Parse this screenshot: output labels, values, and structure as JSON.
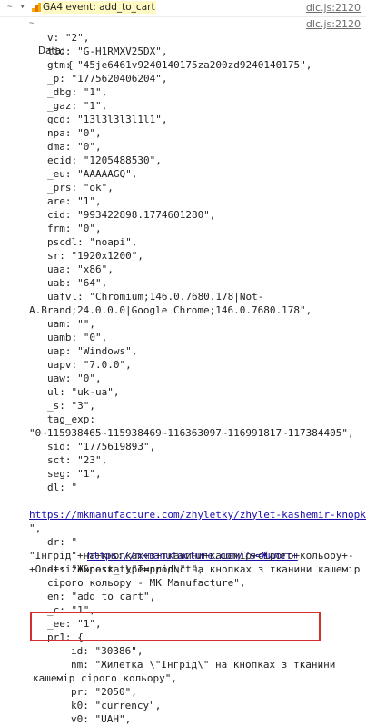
{
  "header": {
    "toggle_glyph": "~",
    "event_label": "GA4 event: add_to_cart",
    "source": "dlc.js:2120"
  },
  "data_header": {
    "toggle_glyph": "~",
    "label": "Data:",
    "brace": "{",
    "source": "dlc.js:2120"
  },
  "rows": [
    {
      "indent": 52,
      "text": "v: \"2\","
    },
    {
      "indent": 52,
      "text": "tid: \"G-H1RMXV25DX\","
    },
    {
      "indent": 52,
      "text": "gtm: \"45je6461v9240140175za200zd9240140175\","
    },
    {
      "indent": 52,
      "text": "_p: \"1775620406204\","
    },
    {
      "indent": 52,
      "text": "_dbg: \"1\","
    },
    {
      "indent": 52,
      "text": "_gaz: \"1\","
    },
    {
      "indent": 52,
      "text": "gcd: \"13l3l3l3l1l1\","
    },
    {
      "indent": 52,
      "text": "npa: \"0\","
    },
    {
      "indent": 52,
      "text": "dma: \"0\","
    },
    {
      "indent": 52,
      "text": "ecid: \"1205488530\","
    },
    {
      "indent": 52,
      "text": "_eu: \"AAAAAGQ\","
    },
    {
      "indent": 52,
      "text": "_prs: \"ok\","
    },
    {
      "indent": 52,
      "text": "are: \"1\","
    },
    {
      "indent": 52,
      "text": "cid: \"993422898.1774601280\","
    },
    {
      "indent": 52,
      "text": "frm: \"0\","
    },
    {
      "indent": 52,
      "text": "pscdl: \"noapi\","
    },
    {
      "indent": 52,
      "text": "sr: \"1920x1200\","
    },
    {
      "indent": 52,
      "text": "uaa: \"x86\","
    },
    {
      "indent": 52,
      "text": "uab: \"64\","
    },
    {
      "indent": 52,
      "text": "uafvl: \"Chromium;146.0.7680.178|Not-"
    },
    {
      "indent": 32,
      "text": "A.Brand;24.0.0.0|Google Chrome;146.0.7680.178\","
    },
    {
      "indent": 52,
      "text": "uam: \"\","
    },
    {
      "indent": 52,
      "text": "uamb: \"0\","
    },
    {
      "indent": 52,
      "text": "uap: \"Windows\","
    },
    {
      "indent": 52,
      "text": "uapv: \"7.0.0\","
    },
    {
      "indent": 52,
      "text": "uaw: \"0\","
    },
    {
      "indent": 52,
      "text": "ul: \"uk-ua\","
    },
    {
      "indent": 52,
      "text": "_s: \"3\","
    },
    {
      "indent": 52,
      "text": "tag_exp:"
    },
    {
      "indent": 32,
      "text": "\"0~115938465~115938469~116363097~116991817~117384405\","
    },
    {
      "indent": 52,
      "text": "sid: \"1775619893\","
    },
    {
      "indent": 52,
      "text": "sct: \"23\","
    },
    {
      "indent": 52,
      "text": "seg: \"1\","
    },
    {
      "indent": 52,
      "text": "dl: \""
    }
  ],
  "dl_url": "https://mkmanufacture.com/zhyletky/zhylet-kashemir-knopky-…",
  "dl_close": "\",",
  "dr": {
    "key": "dr: \"",
    "url": "https://mkmanufacture.com/?s=Жилет+",
    "line2": "\"Інгрід\"+на+кнопках+з+тканини+кашемір+сірого+кольору+-",
    "line3": "+One+size&post_type=product\","
  },
  "rows2": [
    {
      "indent": 52,
      "text": "dt: \"Жилетка \\\"Інгрід\\\" на кнопках з тканини кашемір"
    },
    {
      "indent": 52,
      "text": "сірого кольору - MK Manufacture\","
    },
    {
      "indent": 52,
      "text": "en: \"add_to_cart\","
    },
    {
      "indent": 52,
      "text": "_c: \"1\","
    },
    {
      "indent": 52,
      "text": "_ee: \"1\","
    },
    {
      "indent": 52,
      "text": "pr1: {"
    },
    {
      "indent": 78,
      "text": "id: \"30386\","
    },
    {
      "indent": 78,
      "text": "nm: \"Жилетка \\\"Інгрід\\\" на кнопках з тканини"
    },
    {
      "indent": 36,
      "text": "кашемір сірого кольору\","
    },
    {
      "indent": 78,
      "text": "pr: \"2050\","
    },
    {
      "indent": 78,
      "text": "k0: \"currency\","
    },
    {
      "indent": 78,
      "text": "v0: \"UAH\","
    }
  ]
}
